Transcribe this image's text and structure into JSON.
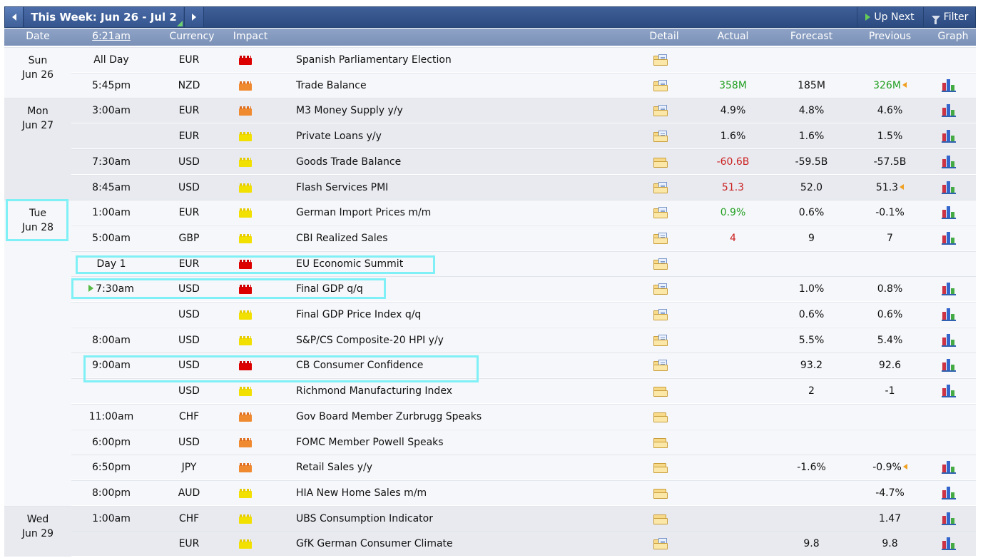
{
  "toolbar": {
    "week_label": "This Week: Jun 26 - Jul 2",
    "up_next_label": "Up Next",
    "filter_label": "Filter"
  },
  "columns": {
    "date": "Date",
    "time": "6:21am",
    "currency": "Currency",
    "impact": "Impact",
    "detail": "Detail",
    "actual": "Actual",
    "forecast": "Forecast",
    "previous": "Previous",
    "graph": "Graph"
  },
  "days": [
    {
      "day": "Sun",
      "date": "Jun 26"
    },
    {
      "day": "Mon",
      "date": "Jun 27"
    },
    {
      "day": "Tue",
      "date": "Jun 28"
    },
    {
      "day": "Wed",
      "date": "Jun 29"
    }
  ],
  "events": [
    {
      "time": "All Day",
      "currency": "EUR",
      "impact": "high",
      "event": "Spanish Parliamentary Election",
      "actual": "",
      "forecast": "",
      "previous": "",
      "graph": false,
      "detail_style": "paper"
    },
    {
      "time": "5:45pm",
      "currency": "NZD",
      "impact": "medium",
      "event": "Trade Balance",
      "actual": "358M",
      "actual_color": "green",
      "forecast": "185M",
      "previous": "326M",
      "previous_color": "green",
      "revised": true,
      "graph": true,
      "detail_style": "paper"
    },
    {
      "time": "3:00am",
      "currency": "EUR",
      "impact": "medium",
      "event": "M3 Money Supply y/y",
      "actual": "4.9%",
      "forecast": "4.8%",
      "previous": "4.6%",
      "graph": true,
      "detail_style": "paper"
    },
    {
      "time": "",
      "currency": "EUR",
      "impact": "low",
      "event": "Private Loans y/y",
      "actual": "1.6%",
      "forecast": "1.6%",
      "previous": "1.5%",
      "graph": true,
      "detail_style": "paper"
    },
    {
      "time": "7:30am",
      "currency": "USD",
      "impact": "low",
      "event": "Goods Trade Balance",
      "actual": "-60.6B",
      "actual_color": "red",
      "forecast": "-59.5B",
      "previous": "-57.5B",
      "graph": true,
      "detail_style": "plain"
    },
    {
      "time": "8:45am",
      "currency": "USD",
      "impact": "low",
      "event": "Flash Services PMI",
      "actual": "51.3",
      "actual_color": "red",
      "forecast": "52.0",
      "previous": "51.3",
      "revised": true,
      "graph": true,
      "detail_style": "paper"
    },
    {
      "time": "1:00am",
      "currency": "EUR",
      "impact": "low",
      "event": "German Import Prices m/m",
      "actual": "0.9%",
      "actual_color": "green",
      "forecast": "0.6%",
      "previous": "-0.1%",
      "graph": true,
      "detail_style": "paper"
    },
    {
      "time": "5:00am",
      "currency": "GBP",
      "impact": "low",
      "event": "CBI Realized Sales",
      "actual": "4",
      "actual_color": "red",
      "forecast": "9",
      "previous": "7",
      "graph": true,
      "detail_style": "paper"
    },
    {
      "time": "Day 1",
      "currency": "EUR",
      "impact": "high",
      "event": "EU Economic Summit",
      "actual": "",
      "forecast": "",
      "previous": "",
      "graph": false,
      "detail_style": "paper"
    },
    {
      "time": "7:30am",
      "currency": "USD",
      "impact": "high",
      "event": "Final GDP q/q",
      "actual": "",
      "forecast": "1.0%",
      "previous": "0.8%",
      "graph": true,
      "detail_style": "paper",
      "now": true
    },
    {
      "time": "",
      "currency": "USD",
      "impact": "low",
      "event": "Final GDP Price Index q/q",
      "actual": "",
      "forecast": "0.6%",
      "previous": "0.6%",
      "graph": true,
      "detail_style": "paper"
    },
    {
      "time": "8:00am",
      "currency": "USD",
      "impact": "low",
      "event": "S&P/CS Composite-20 HPI y/y",
      "actual": "",
      "forecast": "5.5%",
      "previous": "5.4%",
      "graph": true,
      "detail_style": "paper"
    },
    {
      "time": "9:00am",
      "currency": "USD",
      "impact": "high",
      "event": "CB Consumer Confidence",
      "actual": "",
      "forecast": "93.2",
      "previous": "92.6",
      "graph": true,
      "detail_style": "paper"
    },
    {
      "time": "",
      "currency": "USD",
      "impact": "low",
      "event": "Richmond Manufacturing Index",
      "actual": "",
      "forecast": "2",
      "previous": "-1",
      "graph": true,
      "detail_style": "plain"
    },
    {
      "time": "11:00am",
      "currency": "CHF",
      "impact": "medium",
      "event": "Gov Board Member Zurbrugg Speaks",
      "actual": "",
      "forecast": "",
      "previous": "",
      "graph": false,
      "detail_style": "plain"
    },
    {
      "time": "6:00pm",
      "currency": "USD",
      "impact": "medium",
      "event": "FOMC Member Powell Speaks",
      "actual": "",
      "forecast": "",
      "previous": "",
      "graph": false,
      "detail_style": "plain"
    },
    {
      "time": "6:50pm",
      "currency": "JPY",
      "impact": "medium",
      "event": "Retail Sales y/y",
      "actual": "",
      "forecast": "-1.6%",
      "previous": "-0.9%",
      "revised": true,
      "graph": true,
      "detail_style": "plain"
    },
    {
      "time": "8:00pm",
      "currency": "AUD",
      "impact": "low",
      "event": "HIA New Home Sales m/m",
      "actual": "",
      "forecast": "",
      "previous": "-4.7%",
      "graph": true,
      "detail_style": "plain"
    },
    {
      "time": "1:00am",
      "currency": "CHF",
      "impact": "low",
      "event": "UBS Consumption Indicator",
      "actual": "",
      "forecast": "",
      "previous": "1.47",
      "graph": true,
      "detail_style": "plain"
    },
    {
      "time": "",
      "currency": "EUR",
      "impact": "low",
      "event": "GfK German Consumer Climate",
      "actual": "",
      "forecast": "9.8",
      "previous": "9.8",
      "graph": true,
      "detail_style": "paper"
    }
  ],
  "colors": {
    "toolbar": "#2f4f86",
    "header": "#8197bb",
    "positive": "#22a022",
    "negative": "#cc2222",
    "highlight": "#7ff0f5"
  }
}
